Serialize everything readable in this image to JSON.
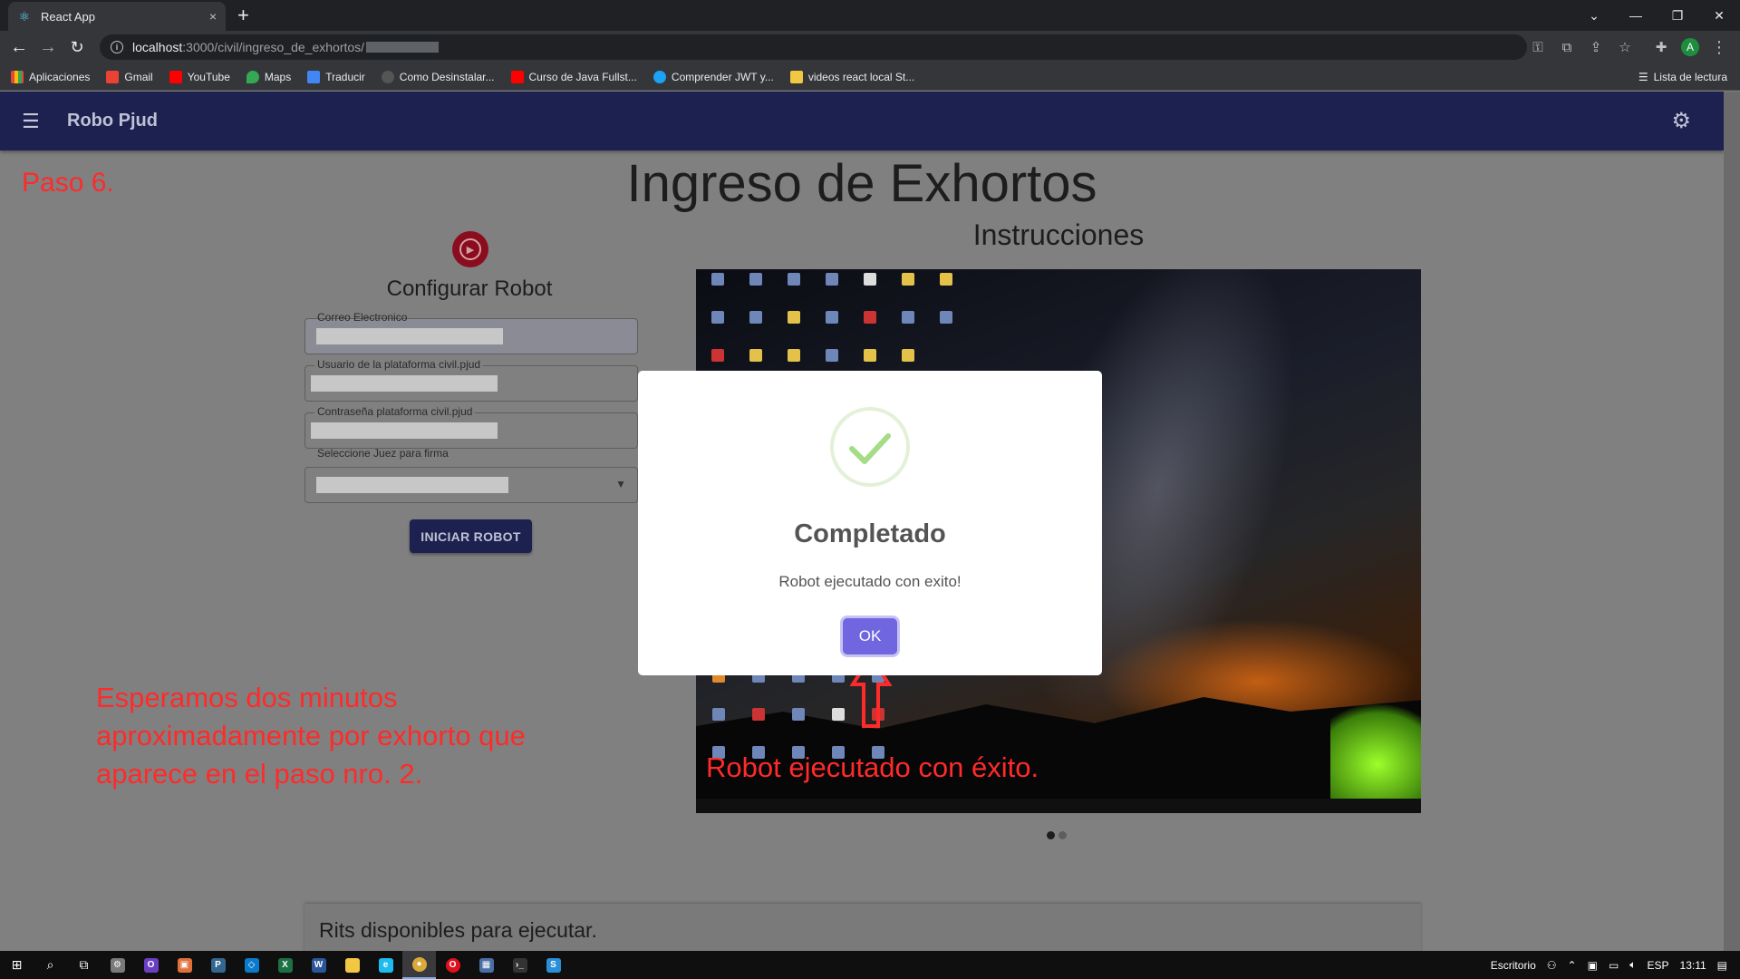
{
  "browser": {
    "tab_title": "React App",
    "tab_close": "×",
    "new_tab": "+",
    "url_host": "localhost",
    "url_path": ":3000/civil/ingreso_de_exhortos/",
    "window_controls": [
      "⌄",
      "—",
      "❐",
      "✕"
    ],
    "bookmarks": [
      {
        "label": "Aplicaciones",
        "color": "#e8453c"
      },
      {
        "label": "Gmail",
        "color": "#ea4335"
      },
      {
        "label": "YouTube",
        "color": "#ff0000"
      },
      {
        "label": "Maps",
        "color": "#34a853"
      },
      {
        "label": "Traducir",
        "color": "#4285f4"
      },
      {
        "label": "Como Desinstalar...",
        "color": "#555555"
      },
      {
        "label": "Curso de Java Fullst...",
        "color": "#ff0000"
      },
      {
        "label": "Comprender JWT y...",
        "color": "#1da1f2"
      },
      {
        "label": "videos react local St...",
        "color": "#f2c744"
      }
    ],
    "reading_list": "Lista de lectura",
    "profile_initial": "A"
  },
  "app": {
    "title": "Robo Pjud",
    "page_title": "Ingreso de Exhortos",
    "instructions_title": "Instrucciones",
    "config_title": "Configurar Robot",
    "fields": {
      "email_label": "Correo Electronico",
      "user_label": "Usuario de la plataforma civil.pjud",
      "password_label": "Contraseña plataforma civil.pjud",
      "judge_label": "Seleccione Juez para firma"
    },
    "start_button": "INICIAR ROBOT",
    "rits_title": "Rits disponibles para ejecutar."
  },
  "annotations": {
    "step": "Paso 6.",
    "note_left": "Esperamos dos minutos aproximadamente por exhorto que aparece en el paso nro. 2.",
    "note_image": "Robot ejecutado con éxito.",
    "color": "#ff2a2a"
  },
  "modal": {
    "title": "Completado",
    "message": "Robot ejecutado con exito!",
    "ok_label": "OK",
    "accent": "#7066e0",
    "check_color": "#a5dc86"
  },
  "carousel": {
    "active_index": 0,
    "count": 2
  },
  "taskbar": {
    "desktop_label": "Escritorio",
    "language": "ESP",
    "time": "13:11"
  }
}
